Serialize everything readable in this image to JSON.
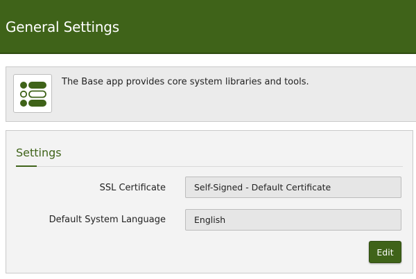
{
  "header": {
    "title": "General Settings"
  },
  "info": {
    "icon": "list-icon",
    "text": "The Base app provides core system libraries and tools."
  },
  "settings": {
    "title": "Settings",
    "fields": [
      {
        "label": "SSL Certificate",
        "value": "Self-Signed - Default Certificate"
      },
      {
        "label": "Default System Language",
        "value": "English"
      }
    ],
    "edit_label": "Edit"
  },
  "colors": {
    "brand": "#3f6319",
    "panel_bg": "#ebebeb",
    "field_bg": "#e6e6e6"
  }
}
